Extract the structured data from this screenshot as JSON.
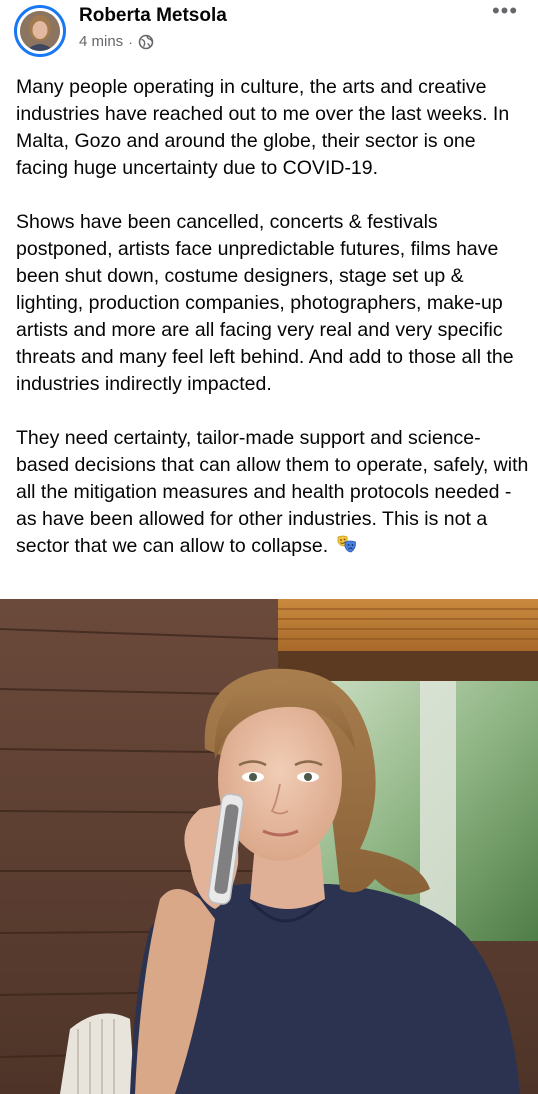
{
  "post": {
    "author": "Roberta Metsola",
    "time": "4 mins",
    "separator": "·",
    "privacy_icon": "globe-icon",
    "more_icon": "more-options-icon",
    "more_label": "•••",
    "paragraphs": [
      "Many people operating in culture, the arts and creative industries have reached out to me over the last weeks. In Malta, Gozo and around the globe, their sector is one facing huge uncertainty due to COVID-19.",
      "Shows have been cancelled, concerts & festivals postponed, artists face unpredictable futures, films have been shut down, costume designers, stage set up & lighting, production companies, photographers, make-up artists and more are all facing very real and very specific threats and many feel left behind. And add to those all the industries indirectly impacted.",
      "They need certainty, tailor-made support and science-based decisions that can allow them to operate, safely, with all the mitigation measures and health protocols needed - as have been allowed for other industries. This is not a sector that we can allow to collapse."
    ],
    "emoji": "performing-arts-masks-icon",
    "photo": "woman-on-phone-photo"
  },
  "colors": {
    "accent": "#1877f2",
    "text": "#050505",
    "secondary_text": "#65676b"
  }
}
